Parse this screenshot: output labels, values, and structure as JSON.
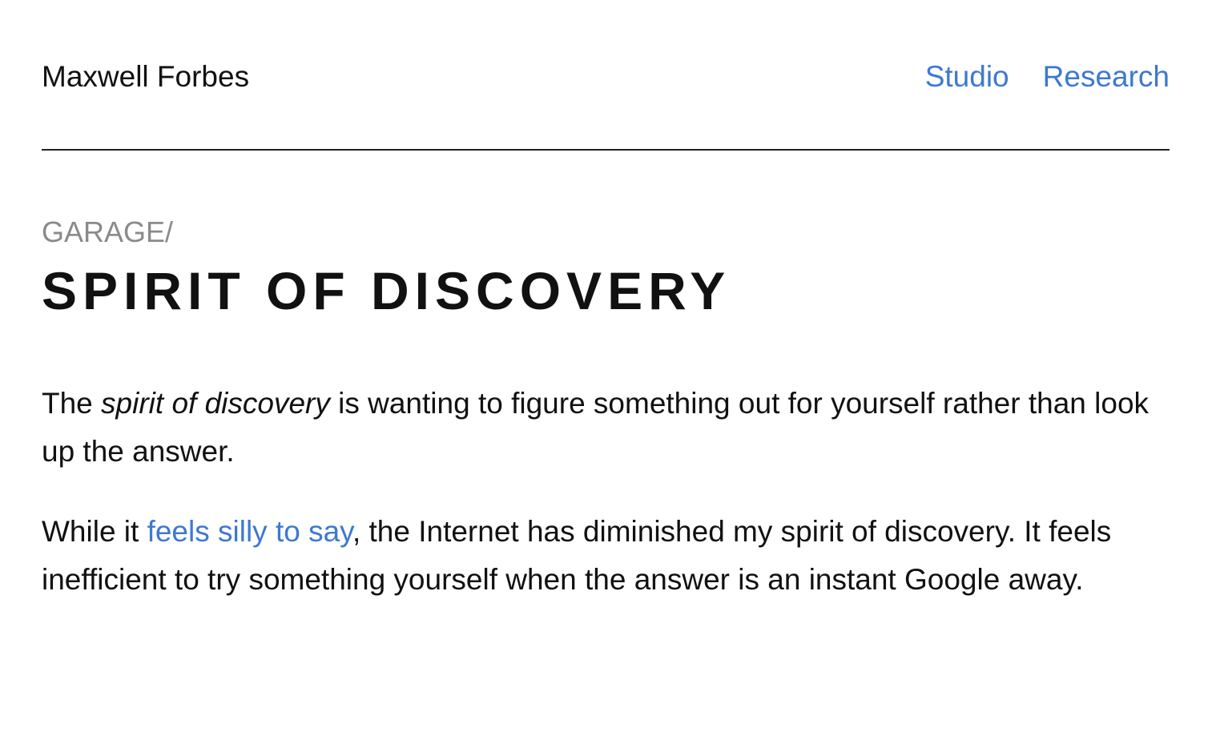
{
  "header": {
    "site_name": "Maxwell Forbes",
    "nav": [
      {
        "label": "Studio"
      },
      {
        "label": "Research"
      }
    ]
  },
  "breadcrumb": "GARAGE/",
  "title": "SPIRIT OF DISCOVERY",
  "paragraph1": {
    "before": "The ",
    "emphasis": "spirit of discovery",
    "after": " is wanting to figure something out for yourself rather than look up the answer."
  },
  "paragraph2": {
    "before": "While it ",
    "link": "feels silly to say",
    "after": ", the Internet has diminished my spirit of discovery. It feels inefficient to try something yourself when the answer is an instant Google away."
  },
  "colors": {
    "link": "#3d78d3",
    "breadcrumb": "#8a8a8a",
    "text": "#111111"
  }
}
